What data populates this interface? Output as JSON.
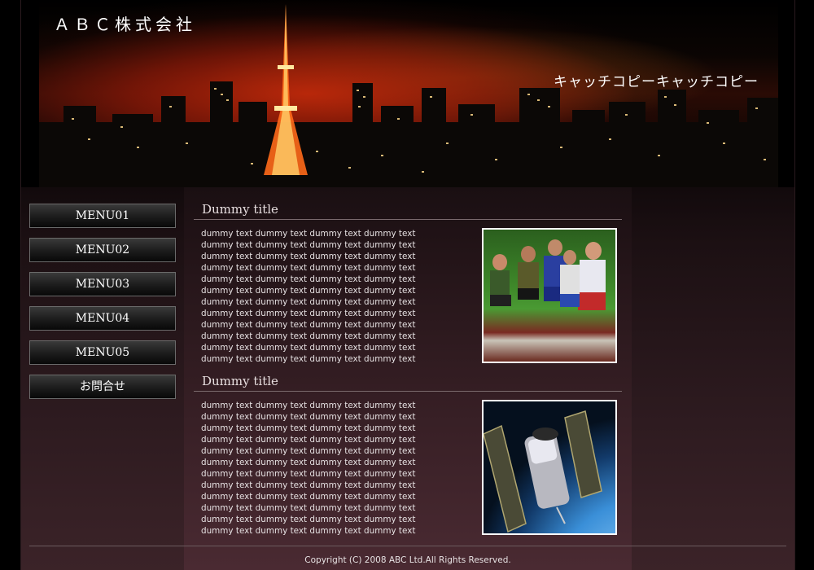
{
  "header": {
    "logo": "ＡＢＣ株式会社",
    "catch_copy": "キャッチコピーキャッチコピー"
  },
  "sidebar": {
    "items": [
      {
        "label": "MENU01"
      },
      {
        "label": "MENU02"
      },
      {
        "label": "MENU03"
      },
      {
        "label": "MENU04"
      },
      {
        "label": "MENU05"
      },
      {
        "label": "お問合せ"
      }
    ]
  },
  "main": {
    "sections": [
      {
        "title": "Dummy title",
        "lines": [
          "dummy text dummy text dummy text dummy text",
          "dummy text dummy text dummy text dummy text",
          "dummy text dummy text dummy text dummy text",
          "dummy text dummy text dummy text dummy text",
          "dummy text dummy text dummy text dummy text",
          "dummy text dummy text dummy text dummy text",
          "dummy text dummy text dummy text dummy text",
          "dummy text dummy text dummy text dummy text",
          "dummy text dummy text dummy text dummy text",
          "dummy text dummy text dummy text dummy text",
          "dummy text dummy text dummy text dummy text",
          "dummy text dummy text dummy text dummy text"
        ]
      },
      {
        "title": "Dummy title",
        "lines": [
          "dummy text dummy text dummy text dummy text",
          "dummy text dummy text dummy text dummy text",
          "dummy text dummy text dummy text dummy text",
          "dummy text dummy text dummy text dummy text",
          "dummy text dummy text dummy text dummy text",
          "dummy text dummy text dummy text dummy text",
          "dummy text dummy text dummy text dummy text",
          "dummy text dummy text dummy text dummy text",
          "dummy text dummy text dummy text dummy text",
          "dummy text dummy text dummy text dummy text",
          "dummy text dummy text dummy text dummy text",
          "dummy text dummy text dummy text dummy text"
        ]
      }
    ]
  },
  "footer": {
    "copyright": "Copyright (C) 2008 ABC Ltd.All Rights Reserved."
  }
}
